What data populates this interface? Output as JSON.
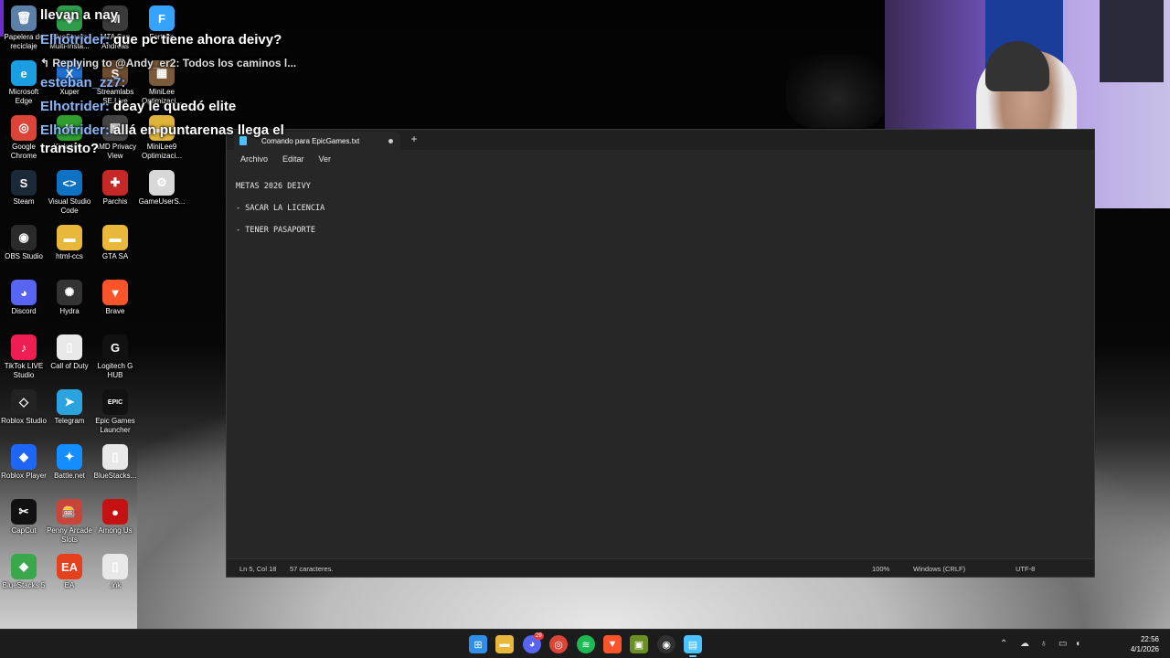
{
  "desktop": {
    "icons": [
      {
        "label": "Papelera de reciclaje",
        "glyph": "🗑",
        "color": "#5b7fa6"
      },
      {
        "label": "BlueStacks Multi-Insta...",
        "glyph": "◆",
        "color": "#2e9c4a"
      },
      {
        "label": "MTA San Andreas",
        "glyph": "M",
        "color": "#3a3a3a"
      },
      {
        "label": "Fortnite",
        "glyph": "F",
        "color": "#35a4ff"
      },
      {
        "label": "Microsoft Edge",
        "glyph": "e",
        "color": "#1b9de2"
      },
      {
        "label": "Xuper",
        "glyph": "X",
        "color": "#1f6fd1"
      },
      {
        "label": "Streamlabs SE.Live",
        "glyph": "S",
        "color": "#6d4c2f"
      },
      {
        "label": "MiniLee Optimizaci...",
        "glyph": "▦",
        "color": "#7b5a3a"
      },
      {
        "label": "Google Chrome",
        "glyph": "◎",
        "color": "#db4437"
      },
      {
        "label": "Kickstat...",
        "glyph": "K",
        "color": "#2f9e2f"
      },
      {
        "label": "AMD Privacy View",
        "glyph": "▣",
        "color": "#444444"
      },
      {
        "label": "MiniLee9 Optimizaci...",
        "glyph": "▬",
        "color": "#e0b33a"
      },
      {
        "label": "Steam",
        "glyph": "S",
        "color": "#1b2838"
      },
      {
        "label": "Visual Studio Code",
        "glyph": "<>",
        "color": "#0e72c4"
      },
      {
        "label": "Parchis",
        "glyph": "✚",
        "color": "#c62828"
      },
      {
        "label": "GameUserS...",
        "glyph": "⚙",
        "color": "#d8d8d8"
      },
      {
        "label": "OBS Studio",
        "glyph": "◉",
        "color": "#2a2a2a"
      },
      {
        "label": "html-ccs",
        "glyph": "▬",
        "color": "#e9b83b"
      },
      {
        "label": "GTA SA",
        "glyph": "▬",
        "color": "#e9b83b"
      },
      {
        "label": "Discord",
        "glyph": "◕",
        "color": "#5865f2"
      },
      {
        "label": "Hydra",
        "glyph": "✺",
        "color": "#333333"
      },
      {
        "label": "Brave",
        "glyph": "▼",
        "color": "#fb542b"
      },
      {
        "label": "TikTok LIVE Studio",
        "glyph": "♪",
        "color": "#ee1d52"
      },
      {
        "label": "Call of Duty",
        "glyph": "▯",
        "color": "#e8e8e8"
      },
      {
        "label": "Logitech G HUB",
        "glyph": "G",
        "color": "#111111"
      },
      {
        "label": "Roblox Studio",
        "glyph": "◇",
        "color": "#222222"
      },
      {
        "label": "Telegram",
        "glyph": "➤",
        "color": "#2aa3de"
      },
      {
        "label": "Epic Games Launcher",
        "glyph": "EPIC",
        "color": "#111111"
      },
      {
        "label": "Roblox Player",
        "glyph": "◆",
        "color": "#1e66f5"
      },
      {
        "label": "Battle.net",
        "glyph": "✦",
        "color": "#148eff"
      },
      {
        "label": "BlueStacks...",
        "glyph": "▯",
        "color": "#e8e8e8"
      },
      {
        "label": "CapCut",
        "glyph": "✂",
        "color": "#111111"
      },
      {
        "label": "Penny Arcade Slots",
        "glyph": "🎰",
        "color": "#c9453a"
      },
      {
        "label": "Among Us",
        "glyph": "●",
        "color": "#c51111"
      },
      {
        "label": "BlueStacks 5",
        "glyph": "◆",
        "color": "#3aa84a"
      },
      {
        "label": "EA",
        "glyph": "EA",
        "color": "#e4411c"
      },
      {
        "label": ".lnk",
        "glyph": "▯",
        "color": "#e8e8e8"
      }
    ]
  },
  "chat": {
    "lines": [
      {
        "user": "",
        "text": "llevan a nay"
      },
      {
        "user": "Elhotrider:",
        "text": "que pc tiene ahora deivy?"
      },
      {
        "user": "",
        "text": "Replying to @Andy_er2: Todos los caminos l...",
        "is_reply": true
      },
      {
        "user": "esteban_zz7:",
        "text": ""
      },
      {
        "user": "Elhotrider:",
        "text": "deay le quedó elite"
      },
      {
        "user": "Elhotrider:",
        "text": "allá en puntarenas llega el"
      },
      {
        "user": "",
        "text": "transito?"
      }
    ]
  },
  "notepad": {
    "tab_title": "Comando para EpicGames.txt",
    "new_tab": "+",
    "menu": [
      "Archivo",
      "Editar",
      "Ver"
    ],
    "lines": [
      "METAS 2026 DEIVY",
      "",
      "- SACAR LA LICENCIA",
      "",
      "- TENER PASAPORTE"
    ],
    "status": {
      "position": "Ln 5, Col 18",
      "chars": "57 caracteres.",
      "zoom": "100%",
      "line_ending": "Windows (CRLF)",
      "encoding": "UTF-8"
    }
  },
  "taskbar": {
    "apps": [
      {
        "name": "start",
        "glyph": "⊞",
        "color": "#2f8fe8"
      },
      {
        "name": "file-explorer",
        "glyph": "▬",
        "color": "#e9b83b"
      },
      {
        "name": "discord",
        "glyph": "◕",
        "color": "#5865f2",
        "badge": "29"
      },
      {
        "name": "chrome",
        "glyph": "◎",
        "color": "#db4437"
      },
      {
        "name": "spotify",
        "glyph": "≋",
        "color": "#1db954"
      },
      {
        "name": "brave",
        "glyph": "▼",
        "color": "#fb542b"
      },
      {
        "name": "minecraft",
        "glyph": "▣",
        "color": "#6b8e23"
      },
      {
        "name": "obs",
        "glyph": "◉",
        "color": "#303030"
      },
      {
        "name": "notepad",
        "glyph": "▤",
        "color": "#4cc2ff"
      }
    ],
    "clock_time": "22:56",
    "clock_date": "4/1/2026"
  }
}
